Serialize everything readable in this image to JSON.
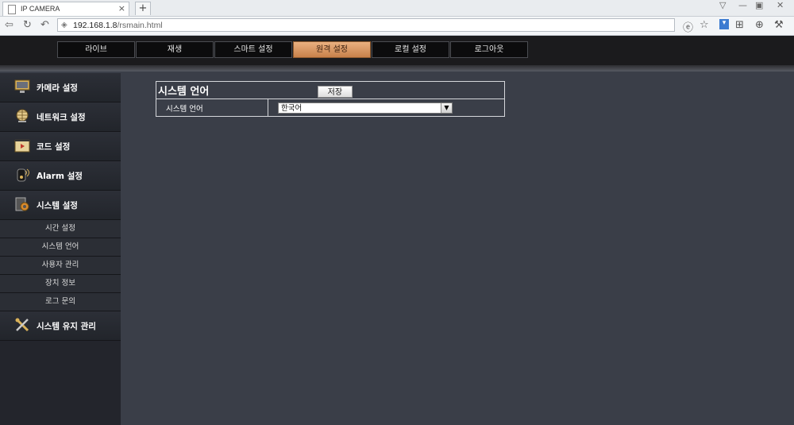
{
  "browser": {
    "tab_title": "IP CAMERA",
    "tab_close": "×",
    "new_tab": "+",
    "url_host": "192.168.1.8",
    "url_path": "/rsmain.html"
  },
  "top_menu": [
    {
      "label": "라이브",
      "active": false
    },
    {
      "label": "재생",
      "active": false
    },
    {
      "label": "스마트 설정",
      "active": false
    },
    {
      "label": "원격 설정",
      "active": true
    },
    {
      "label": "로컬 설정",
      "active": false
    },
    {
      "label": "로그아웃",
      "active": false
    }
  ],
  "sidebar": {
    "camera_settings": "카메라 설정",
    "network_settings": "네트워크 설정",
    "code_settings": "코드 설정",
    "alarm_settings": "Alarm 설정",
    "system_settings": "시스템 설정",
    "sub_items": [
      "시간 설정",
      "시스템 언어",
      "사용자 관리",
      "장치 정보",
      "로그 문의"
    ],
    "maintenance": "시스템 유지 관리"
  },
  "panel": {
    "title": "시스템 언어",
    "save_label": "저장",
    "row_label": "시스템 언어",
    "language_value": "한국어"
  },
  "colors": {
    "accent_active_tab": "#d99a66",
    "background": "#3a3e48",
    "sidebar": "#23252c"
  }
}
